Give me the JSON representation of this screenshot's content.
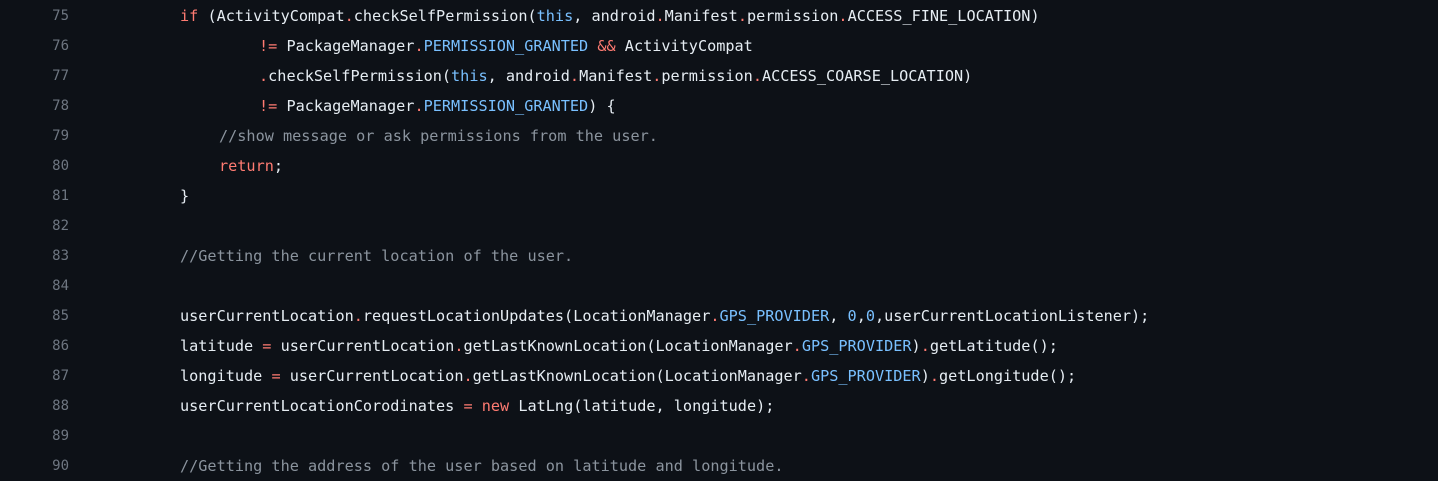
{
  "theme": {
    "background": "#0d1117",
    "line_number_color": "#6e7681",
    "text_color": "#e6edf3",
    "keyword_color": "#ff7b72",
    "constant_color": "#79c0ff",
    "comment_color": "#8b949e"
  },
  "lines": [
    {
      "num": "75",
      "tokens": [
        {
          "t": "if",
          "c": "kw"
        },
        {
          "t": " (ActivityCompat",
          "c": "plain"
        },
        {
          "t": ".",
          "c": "kw"
        },
        {
          "t": "checkSelfPermission(",
          "c": "plain"
        },
        {
          "t": "this",
          "c": "const"
        },
        {
          "t": ", android",
          "c": "plain"
        },
        {
          "t": ".",
          "c": "kw"
        },
        {
          "t": "Manifest",
          "c": "plain"
        },
        {
          "t": ".",
          "c": "kw"
        },
        {
          "t": "permission",
          "c": "plain"
        },
        {
          "t": ".",
          "c": "kw"
        },
        {
          "t": "ACCESS_FINE_LOCATION)",
          "c": "plain"
        }
      ]
    },
    {
      "num": "76",
      "tokens": [
        {
          "t": "!=",
          "c": "kw"
        },
        {
          "t": " PackageManager",
          "c": "plain"
        },
        {
          "t": ".",
          "c": "kw"
        },
        {
          "t": "PERMISSION_GRANTED",
          "c": "const"
        },
        {
          "t": " ",
          "c": "plain"
        },
        {
          "t": "&&",
          "c": "kw"
        },
        {
          "t": " ActivityCompat",
          "c": "plain"
        }
      ]
    },
    {
      "num": "77",
      "tokens": [
        {
          "t": ".",
          "c": "kw"
        },
        {
          "t": "checkSelfPermission(",
          "c": "plain"
        },
        {
          "t": "this",
          "c": "const"
        },
        {
          "t": ", android",
          "c": "plain"
        },
        {
          "t": ".",
          "c": "kw"
        },
        {
          "t": "Manifest",
          "c": "plain"
        },
        {
          "t": ".",
          "c": "kw"
        },
        {
          "t": "permission",
          "c": "plain"
        },
        {
          "t": ".",
          "c": "kw"
        },
        {
          "t": "ACCESS_COARSE_LOCATION)",
          "c": "plain"
        }
      ]
    },
    {
      "num": "78",
      "tokens": [
        {
          "t": "!=",
          "c": "kw"
        },
        {
          "t": " PackageManager",
          "c": "plain"
        },
        {
          "t": ".",
          "c": "kw"
        },
        {
          "t": "PERMISSION_GRANTED",
          "c": "const"
        },
        {
          "t": ") {",
          "c": "plain"
        }
      ]
    },
    {
      "num": "79",
      "tokens": [
        {
          "t": "//show message or ask permissions from the user.",
          "c": "cmt"
        }
      ]
    },
    {
      "num": "80",
      "tokens": [
        {
          "t": "return",
          "c": "kw"
        },
        {
          "t": ";",
          "c": "plain"
        }
      ]
    },
    {
      "num": "81",
      "tokens": [
        {
          "t": "}",
          "c": "plain"
        }
      ]
    },
    {
      "num": "82",
      "tokens": []
    },
    {
      "num": "83",
      "tokens": [
        {
          "t": "//Getting the current location of the user.",
          "c": "cmt"
        }
      ]
    },
    {
      "num": "84",
      "tokens": []
    },
    {
      "num": "85",
      "tokens": [
        {
          "t": "userCurrentLocation",
          "c": "plain"
        },
        {
          "t": ".",
          "c": "kw"
        },
        {
          "t": "requestLocationUpdates(LocationManager",
          "c": "plain"
        },
        {
          "t": ".",
          "c": "kw"
        },
        {
          "t": "GPS_PROVIDER",
          "c": "const"
        },
        {
          "t": ", ",
          "c": "plain"
        },
        {
          "t": "0",
          "c": "const"
        },
        {
          "t": ",",
          "c": "plain"
        },
        {
          "t": "0",
          "c": "const"
        },
        {
          "t": ",userCurrentLocationListener);",
          "c": "plain"
        }
      ]
    },
    {
      "num": "86",
      "tokens": [
        {
          "t": "latitude ",
          "c": "plain"
        },
        {
          "t": "=",
          "c": "kw"
        },
        {
          "t": " userCurrentLocation",
          "c": "plain"
        },
        {
          "t": ".",
          "c": "kw"
        },
        {
          "t": "getLastKnownLocation(LocationManager",
          "c": "plain"
        },
        {
          "t": ".",
          "c": "kw"
        },
        {
          "t": "GPS_PROVIDER",
          "c": "const"
        },
        {
          "t": ")",
          "c": "plain"
        },
        {
          "t": ".",
          "c": "kw"
        },
        {
          "t": "getLatitude();",
          "c": "plain"
        }
      ]
    },
    {
      "num": "87",
      "tokens": [
        {
          "t": "longitude ",
          "c": "plain"
        },
        {
          "t": "=",
          "c": "kw"
        },
        {
          "t": " userCurrentLocation",
          "c": "plain"
        },
        {
          "t": ".",
          "c": "kw"
        },
        {
          "t": "getLastKnownLocation(LocationManager",
          "c": "plain"
        },
        {
          "t": ".",
          "c": "kw"
        },
        {
          "t": "GPS_PROVIDER",
          "c": "const"
        },
        {
          "t": ")",
          "c": "plain"
        },
        {
          "t": ".",
          "c": "kw"
        },
        {
          "t": "getLongitude();",
          "c": "plain"
        }
      ]
    },
    {
      "num": "88",
      "tokens": [
        {
          "t": "userCurrentLocationCorodinates ",
          "c": "plain"
        },
        {
          "t": "=",
          "c": "kw"
        },
        {
          "t": " ",
          "c": "plain"
        },
        {
          "t": "new",
          "c": "kw"
        },
        {
          "t": " LatLng(latitude, longitude);",
          "c": "plain"
        }
      ]
    },
    {
      "num": "89",
      "tokens": []
    },
    {
      "num": "90",
      "tokens": [
        {
          "t": "//Getting the address of the user based on latitude and longitude.",
          "c": "cmt"
        }
      ]
    }
  ]
}
